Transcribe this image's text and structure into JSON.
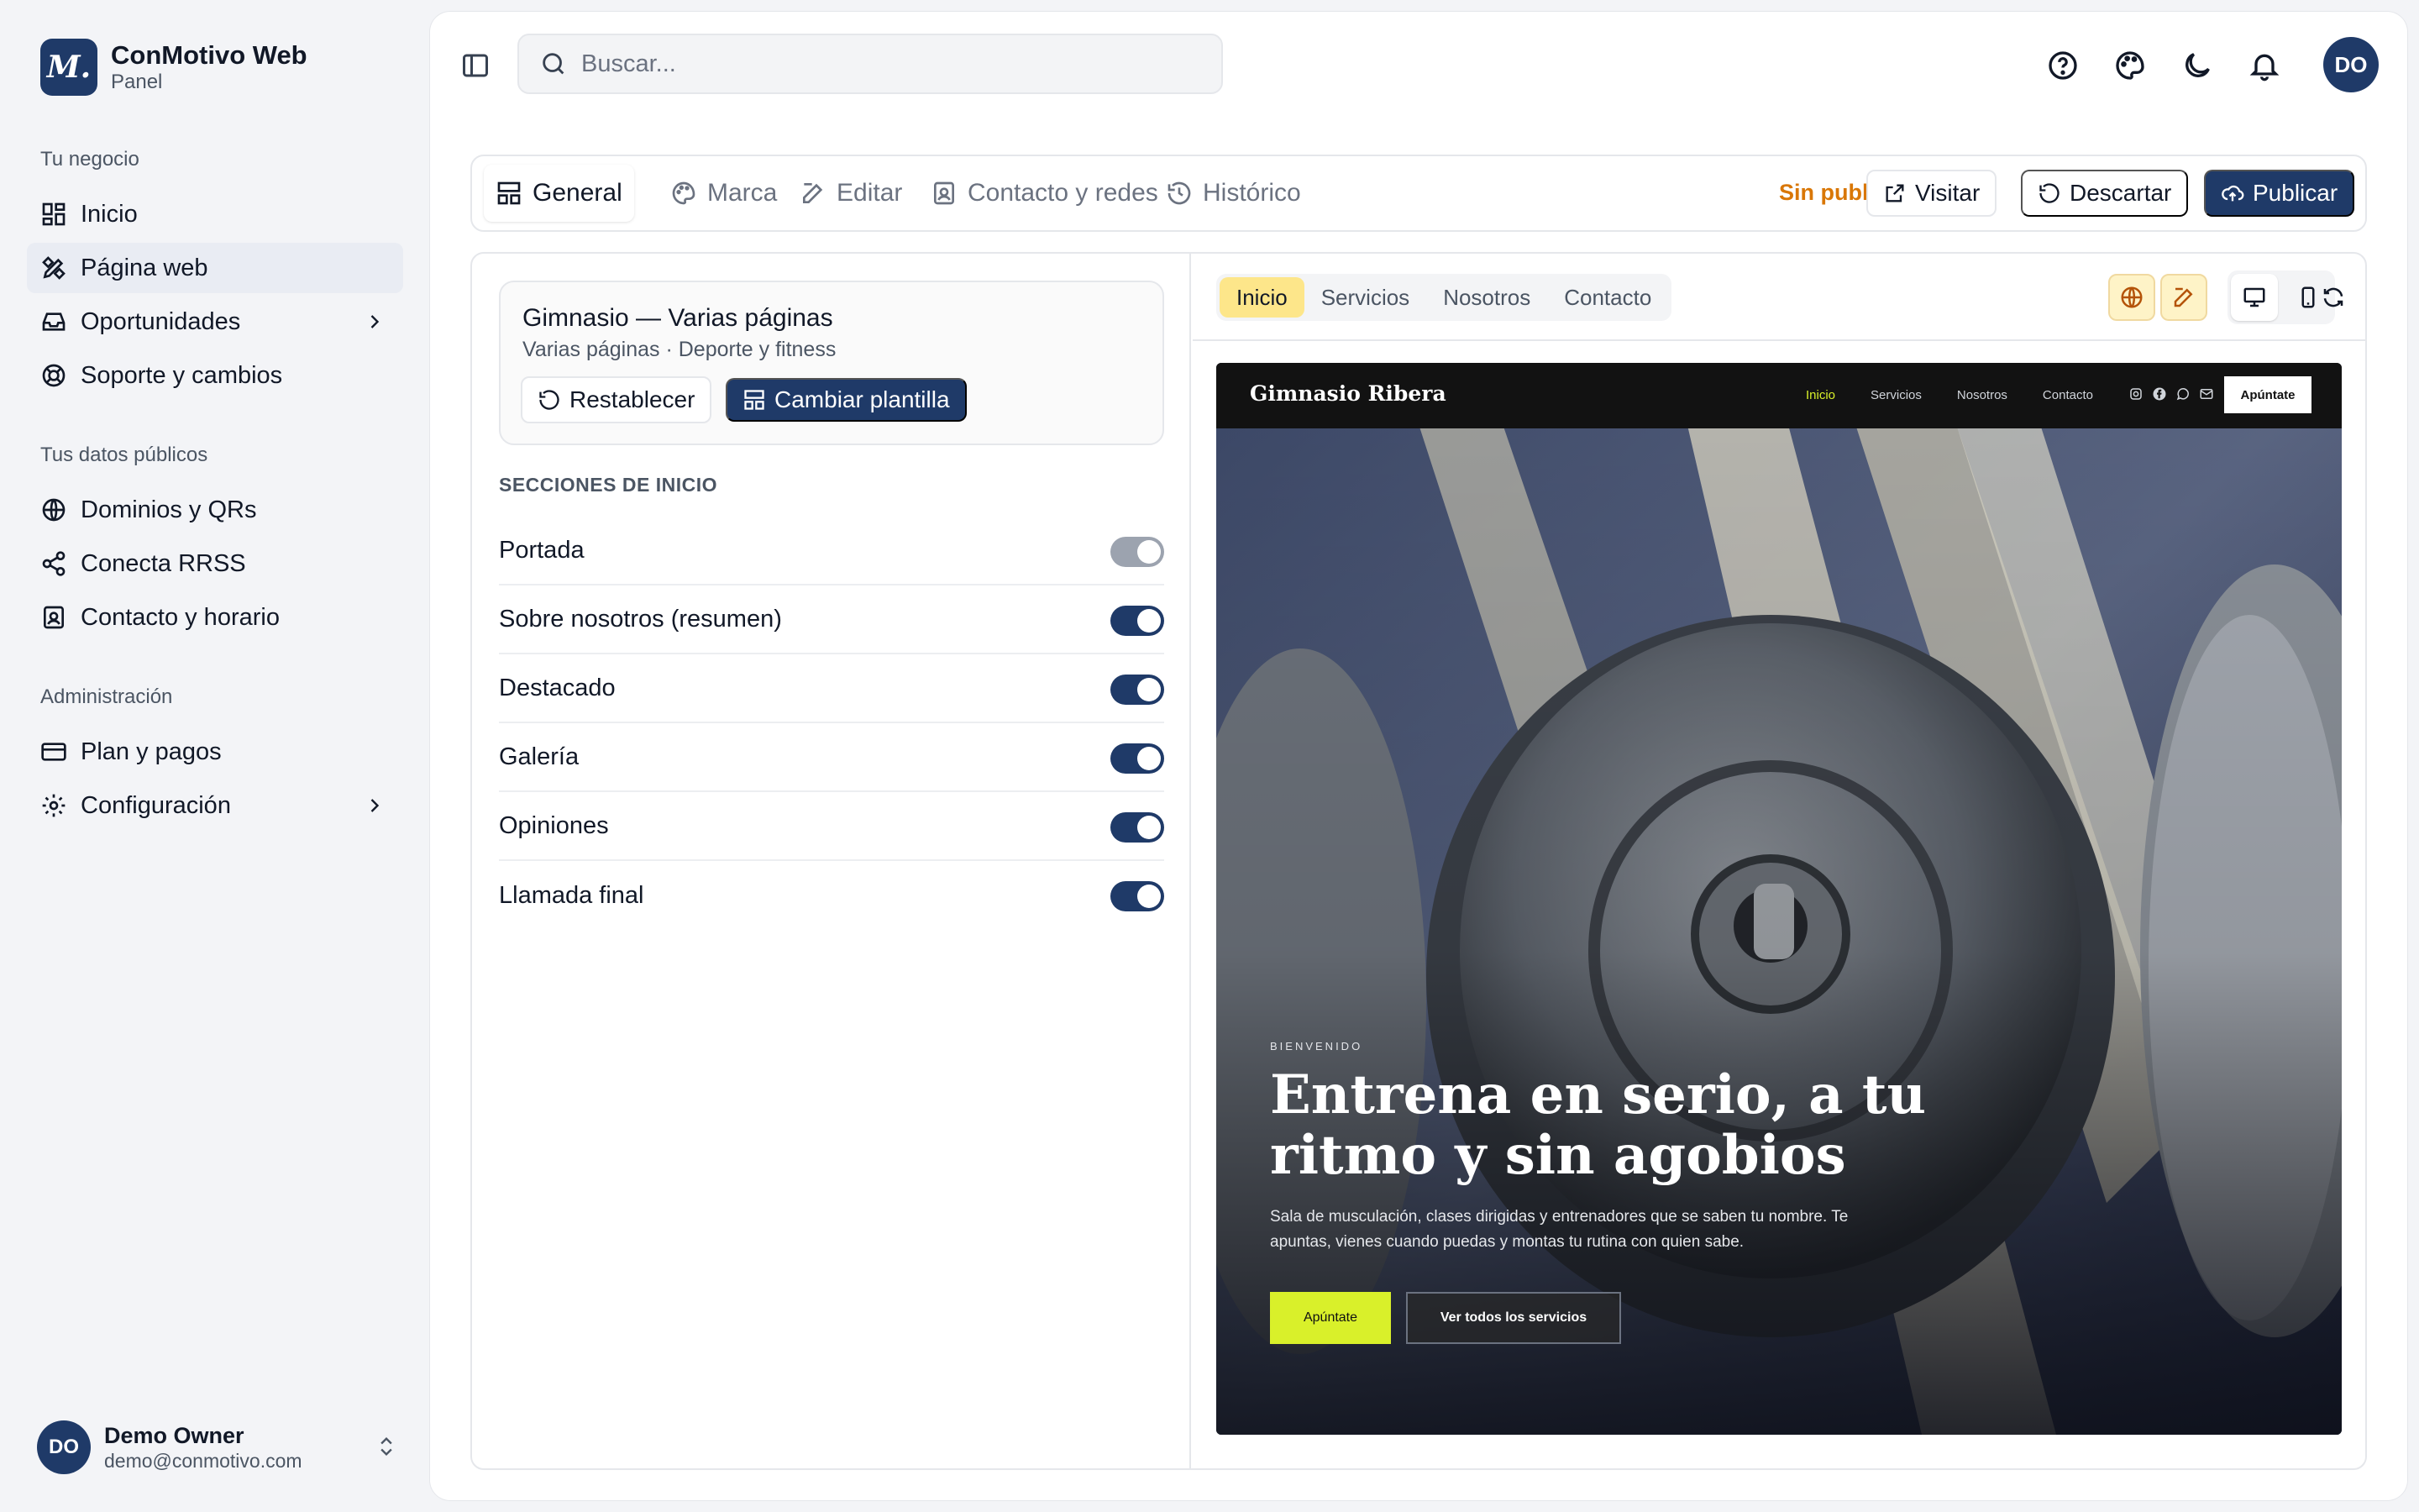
{
  "brand": {
    "logo_letter": "M.",
    "name": "ConMotivo Web",
    "subtitle": "Panel"
  },
  "sidebar": {
    "groups": [
      {
        "label": "Tu negocio",
        "items": [
          {
            "label": "Inicio",
            "icon": "dashboard-icon"
          },
          {
            "label": "Página web",
            "icon": "design-tools-icon",
            "active": true
          },
          {
            "label": "Oportunidades",
            "icon": "inbox-icon",
            "has_submenu": true
          },
          {
            "label": "Soporte y cambios",
            "icon": "lifebuoy-icon"
          }
        ]
      },
      {
        "label": "Tus datos públicos",
        "items": [
          {
            "label": "Dominios y QRs",
            "icon": "globe-icon"
          },
          {
            "label": "Conecta RRSS",
            "icon": "share-icon"
          },
          {
            "label": "Contacto y horario",
            "icon": "contact-card-icon"
          }
        ]
      },
      {
        "label": "Administración",
        "items": [
          {
            "label": "Plan y pagos",
            "icon": "credit-card-icon"
          },
          {
            "label": "Configuración",
            "icon": "gear-icon",
            "has_submenu": true
          }
        ]
      }
    ]
  },
  "user": {
    "initials": "DO",
    "name": "Demo Owner",
    "email": "demo@conmotivo.com"
  },
  "topbar": {
    "search_placeholder": "Buscar...",
    "avatar_initials": "DO"
  },
  "tabs": [
    {
      "label": "General",
      "icon": "layout-icon",
      "active": true
    },
    {
      "label": "Marca",
      "icon": "palette-icon"
    },
    {
      "label": "Editar",
      "icon": "edit-icon"
    },
    {
      "label": "Contacto y redes",
      "icon": "contact-card-icon"
    },
    {
      "label": "Histórico",
      "icon": "history-icon"
    }
  ],
  "actions": {
    "status": "Sin publicar",
    "visit": "Visitar",
    "discard": "Descartar",
    "publish": "Publicar"
  },
  "template": {
    "name": "Gimnasio — Varias páginas",
    "description": "Varias páginas · Deporte y fitness",
    "reset": "Restablecer",
    "change": "Cambiar plantilla"
  },
  "sections": {
    "heading": "SECCIONES DE INICIO",
    "items": [
      {
        "label": "Portada",
        "enabled": true,
        "locked": true
      },
      {
        "label": "Sobre nosotros (resumen)",
        "enabled": true
      },
      {
        "label": "Destacado",
        "enabled": true
      },
      {
        "label": "Galería",
        "enabled": true
      },
      {
        "label": "Opiniones",
        "enabled": true
      },
      {
        "label": "Llamada final",
        "enabled": true
      }
    ]
  },
  "preview": {
    "pages": [
      {
        "label": "Inicio",
        "active": true
      },
      {
        "label": "Servicios"
      },
      {
        "label": "Nosotros"
      },
      {
        "label": "Contacto"
      }
    ],
    "site": {
      "brand": "Gimnasio Ribera",
      "nav": [
        "Inicio",
        "Servicios",
        "Nosotros",
        "Contacto"
      ],
      "nav_cta": "Apúntate",
      "kicker": "BIENVENIDO",
      "title": "Entrena en serio, a tu ritmo y sin agobios",
      "text": "Sala de musculación, clases dirigidas y entrenadores que se saben tu nombre. Te apuntas, vienes cuando puedas y montas tu rutina con quien sabe.",
      "cta_primary": "Apúntate",
      "cta_secondary": "Ver todos los servicios",
      "accent": "#d9f02a"
    }
  },
  "colors": {
    "primary": "#1f3a68",
    "warning": "#d97706",
    "highlight": "#fde68a"
  }
}
